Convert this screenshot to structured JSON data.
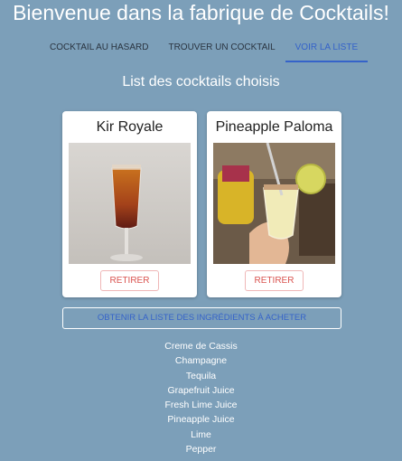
{
  "header": {
    "title": "Bienvenue dans la fabrique de Cocktails!"
  },
  "tabs": [
    {
      "label": "COCKTAIL AU HASARD"
    },
    {
      "label": "TROUVER UN COCKTAIL"
    },
    {
      "label": "VOIR LA LISTE",
      "active": true
    }
  ],
  "main": {
    "section_title": "List des cocktails choisis"
  },
  "cards": [
    {
      "title": "Kir Royale",
      "image": "kir-royale-photo",
      "remove_label": "RETIRER"
    },
    {
      "title": "Pineapple Paloma",
      "image": "pineapple-paloma-photo",
      "remove_label": "RETIRER"
    }
  ],
  "ingredients_button": {
    "label": "OBTENIR LA LISTE DES INGRÉDIENTS À ACHETER"
  },
  "ingredients": [
    "Creme de Cassis",
    "Champagne",
    "Tequila",
    "Grapefruit Juice",
    "Fresh Lime Juice",
    "Pineapple Juice",
    "Lime",
    "Pepper"
  ],
  "colors": {
    "background": "#7c9fb9",
    "accent": "#3563c9",
    "remove": "#d9534f",
    "card": "#ffffff"
  }
}
